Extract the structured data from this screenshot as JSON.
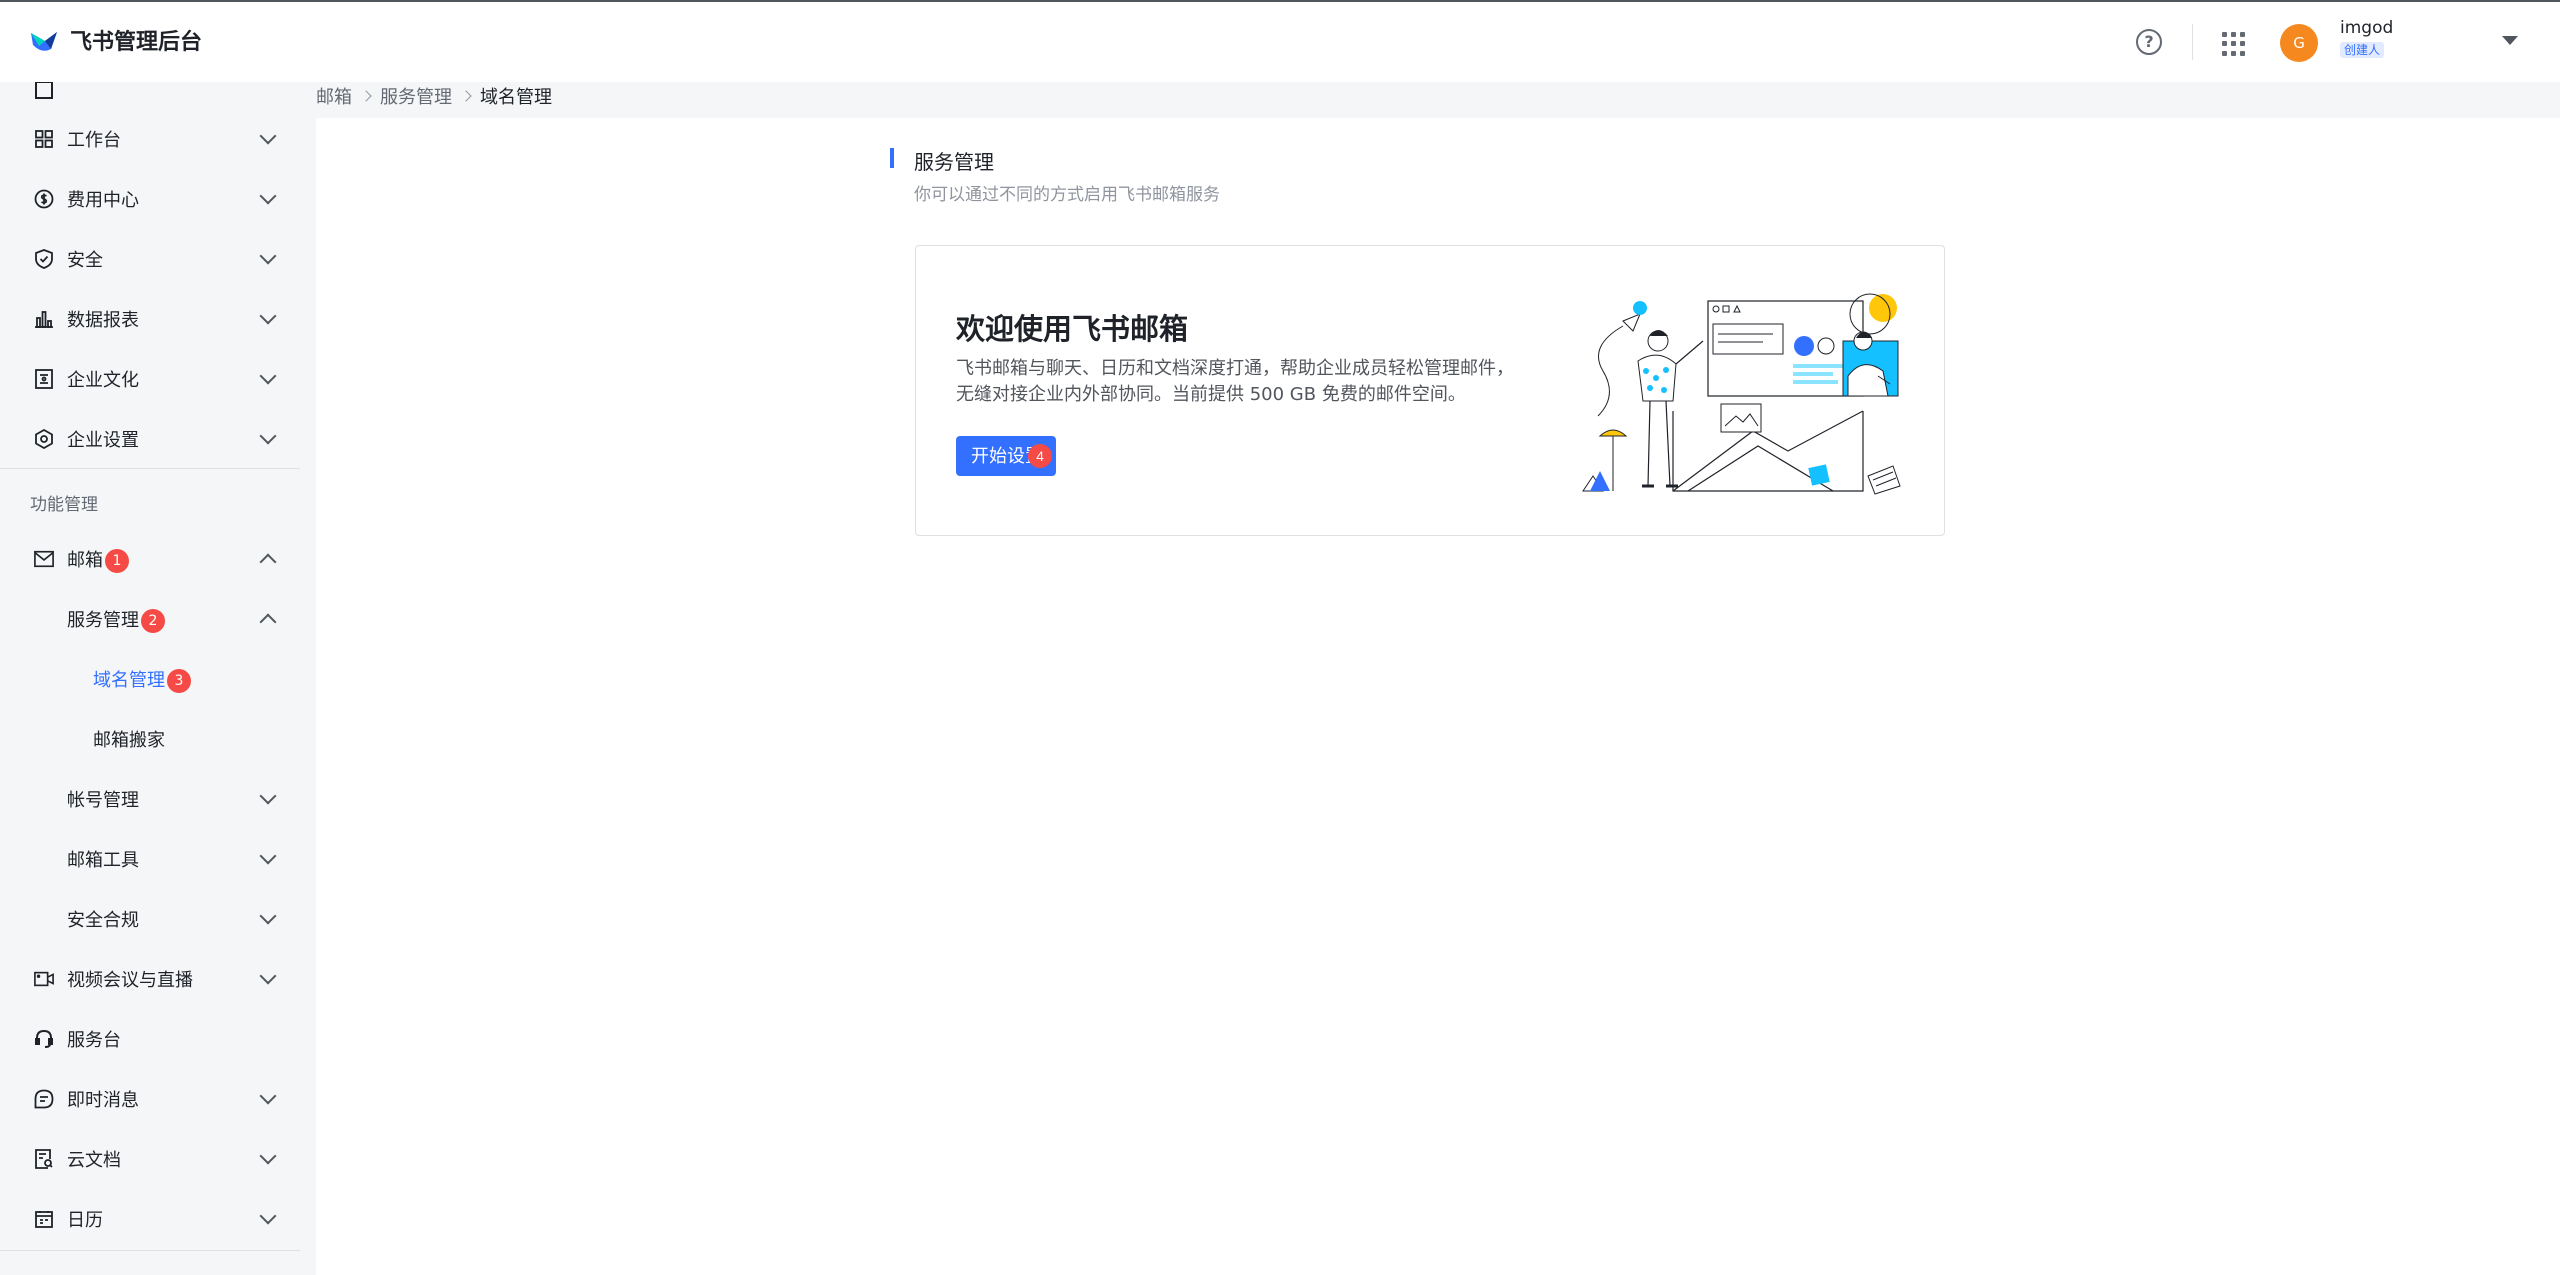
{
  "header": {
    "app_name": "飞书管理后台",
    "help_label": "?",
    "user": {
      "avatar_letter": "G",
      "name": "imgod",
      "role": "创建人"
    }
  },
  "sidebar": {
    "items_top": [
      {
        "label": "工作台",
        "icon": "workbench-icon"
      },
      {
        "label": "费用中心",
        "icon": "cost-icon"
      },
      {
        "label": "安全",
        "icon": "shield-icon"
      },
      {
        "label": "数据报表",
        "icon": "chart-icon"
      },
      {
        "label": "企业文化",
        "icon": "culture-icon"
      },
      {
        "label": "企业设置",
        "icon": "settings-icon"
      }
    ],
    "section_label": "功能管理",
    "mail": {
      "label": "邮箱",
      "badge": "1"
    },
    "service_mgmt": {
      "label": "服务管理",
      "badge": "2"
    },
    "domain_mgmt": {
      "label": "域名管理",
      "badge": "3"
    },
    "mail_move": {
      "label": "邮箱搬家"
    },
    "account_mgmt": {
      "label": "帐号管理"
    },
    "mail_tools": {
      "label": "邮箱工具"
    },
    "security_compliance": {
      "label": "安全合规"
    },
    "items_bottom": [
      {
        "label": "视频会议与直播",
        "icon": "video-icon"
      },
      {
        "label": "服务台",
        "icon": "headset-icon"
      },
      {
        "label": "即时消息",
        "icon": "chat-icon"
      },
      {
        "label": "云文档",
        "icon": "doc-icon"
      },
      {
        "label": "日历",
        "icon": "calendar-icon"
      }
    ]
  },
  "breadcrumb": [
    "邮箱",
    "服务管理",
    "域名管理"
  ],
  "main": {
    "section_title": "服务管理",
    "section_subtitle": "你可以通过不同的方式启用飞书邮箱服务",
    "card": {
      "title": "欢迎使用飞书邮箱",
      "description": "飞书邮箱与聊天、日历和文档深度打通，帮助企业成员轻松管理邮件，无缝对接企业内外部协同。当前提供 500 GB 免费的邮件空间。",
      "button_label": "开始设置",
      "button_badge": "4"
    }
  },
  "colors": {
    "accent": "#3370ff",
    "badge": "#f54a45",
    "avatar": "#f5891f"
  }
}
